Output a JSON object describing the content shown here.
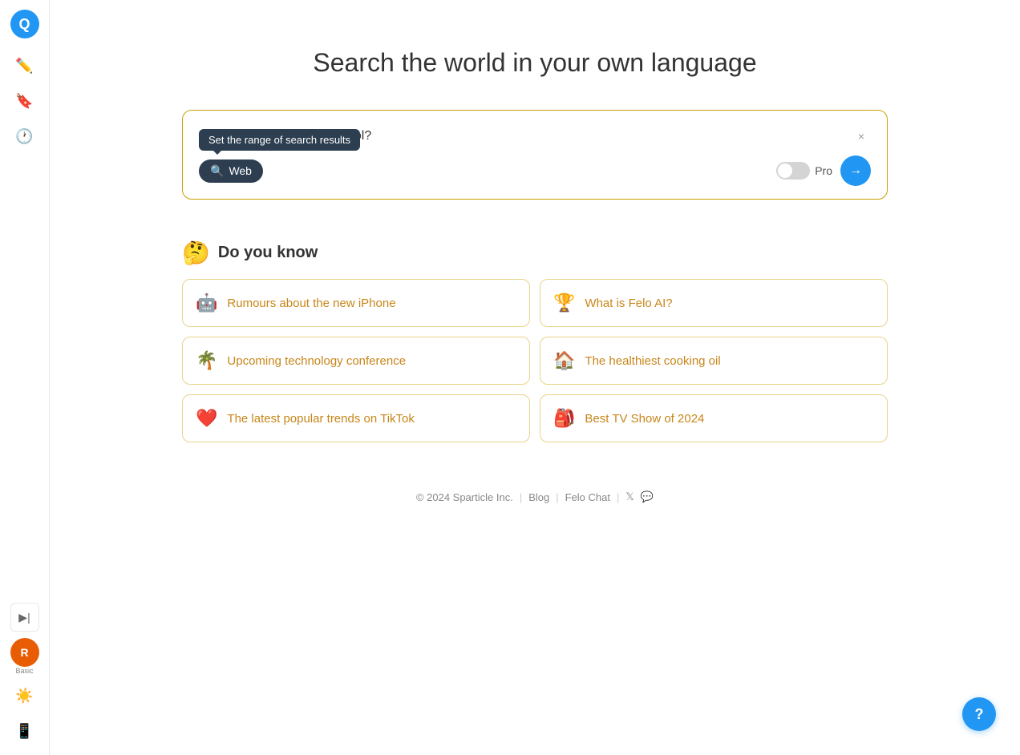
{
  "sidebar": {
    "logo_label": "Q",
    "items": [
      {
        "id": "new-chat",
        "icon": "➕",
        "label": "New Chat"
      },
      {
        "id": "bookmarks",
        "icon": "🔖",
        "label": "Bookmarks"
      },
      {
        "id": "history",
        "icon": "🕐",
        "label": "History"
      }
    ],
    "collapse_icon": "▶|",
    "avatar_label": "R",
    "avatar_sublabel": "Basic"
  },
  "header": {
    "title": "Search the world in your own language"
  },
  "search": {
    "query": "Do eggs increase cholesterol?",
    "clear_label": "×",
    "web_button_label": "Web",
    "pro_label": "Pro",
    "submit_icon": "→",
    "tooltip_text": "Set the range of search results"
  },
  "do_you_know": {
    "emoji": "🤔",
    "title": "Do you know",
    "cards": [
      {
        "id": "iphone",
        "emoji": "🤖",
        "text": "Rumours about the new iPhone"
      },
      {
        "id": "felo",
        "emoji": "🏆",
        "text": "What is Felo AI?"
      },
      {
        "id": "tech-conf",
        "emoji": "🌴",
        "text": "Upcoming technology conference"
      },
      {
        "id": "cooking-oil",
        "emoji": "🏠",
        "text": "The healthiest cooking oil"
      },
      {
        "id": "tiktok",
        "emoji": "❤️",
        "text": "The latest popular trends on TikTok"
      },
      {
        "id": "tv-show",
        "emoji": "🎒",
        "text": "Best TV Show of 2024"
      }
    ]
  },
  "footer": {
    "copyright": "© 2024 Sparticle Inc.",
    "links": [
      {
        "id": "blog",
        "label": "Blog"
      },
      {
        "id": "felo-chat",
        "label": "Felo Chat"
      },
      {
        "id": "twitter",
        "label": "𝕏"
      },
      {
        "id": "discord",
        "label": "💬"
      }
    ]
  },
  "help": {
    "icon": "?"
  }
}
